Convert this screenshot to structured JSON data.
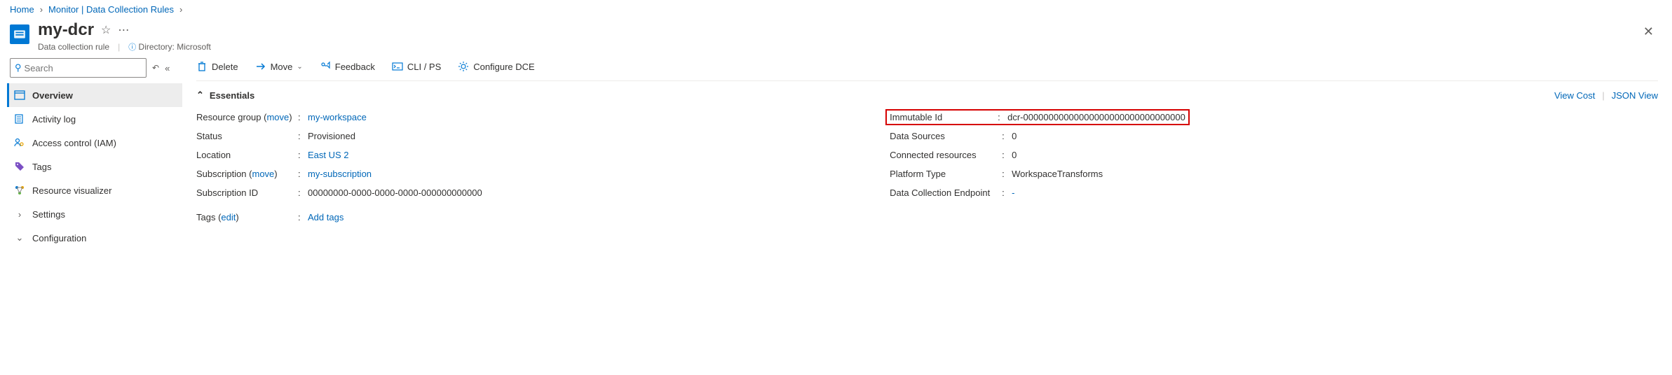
{
  "breadcrumb": {
    "home": "Home",
    "monitor": "Monitor | Data Collection Rules"
  },
  "header": {
    "title": "my-dcr",
    "subtitle": "Data collection rule",
    "directory_label": "Directory: Microsoft"
  },
  "search": {
    "placeholder": "Search"
  },
  "sidebar": {
    "items": [
      {
        "label": "Overview"
      },
      {
        "label": "Activity log"
      },
      {
        "label": "Access control (IAM)"
      },
      {
        "label": "Tags"
      },
      {
        "label": "Resource visualizer"
      },
      {
        "label": "Settings"
      },
      {
        "label": "Configuration"
      }
    ]
  },
  "toolbar": {
    "delete": "Delete",
    "move": "Move",
    "feedback": "Feedback",
    "cli": "CLI / PS",
    "dce": "Configure DCE"
  },
  "essentials": {
    "toggle": "Essentials",
    "viewcost": "View Cost",
    "jsonview": "JSON View",
    "left": {
      "rg_label": "Resource group",
      "move": "move",
      "rg_value": "my-workspace",
      "status_label": "Status",
      "status_value": "Provisioned",
      "loc_label": "Location",
      "loc_value": "East US 2",
      "sub_label": "Subscription",
      "sub_value": "my-subscription",
      "subid_label": "Subscription ID",
      "subid_value": "00000000-0000-0000-0000-000000000000",
      "tags_label": "Tags",
      "edit": "edit",
      "tags_value": "Add tags"
    },
    "right": {
      "imm_label": "Immutable Id",
      "imm_value": "dcr-00000000000000000000000000000000",
      "ds_label": "Data Sources",
      "ds_value": "0",
      "cr_label": "Connected resources",
      "cr_value": "0",
      "pt_label": "Platform Type",
      "pt_value": "WorkspaceTransforms",
      "dce_label": "Data Collection Endpoint",
      "dce_value": "-"
    }
  }
}
